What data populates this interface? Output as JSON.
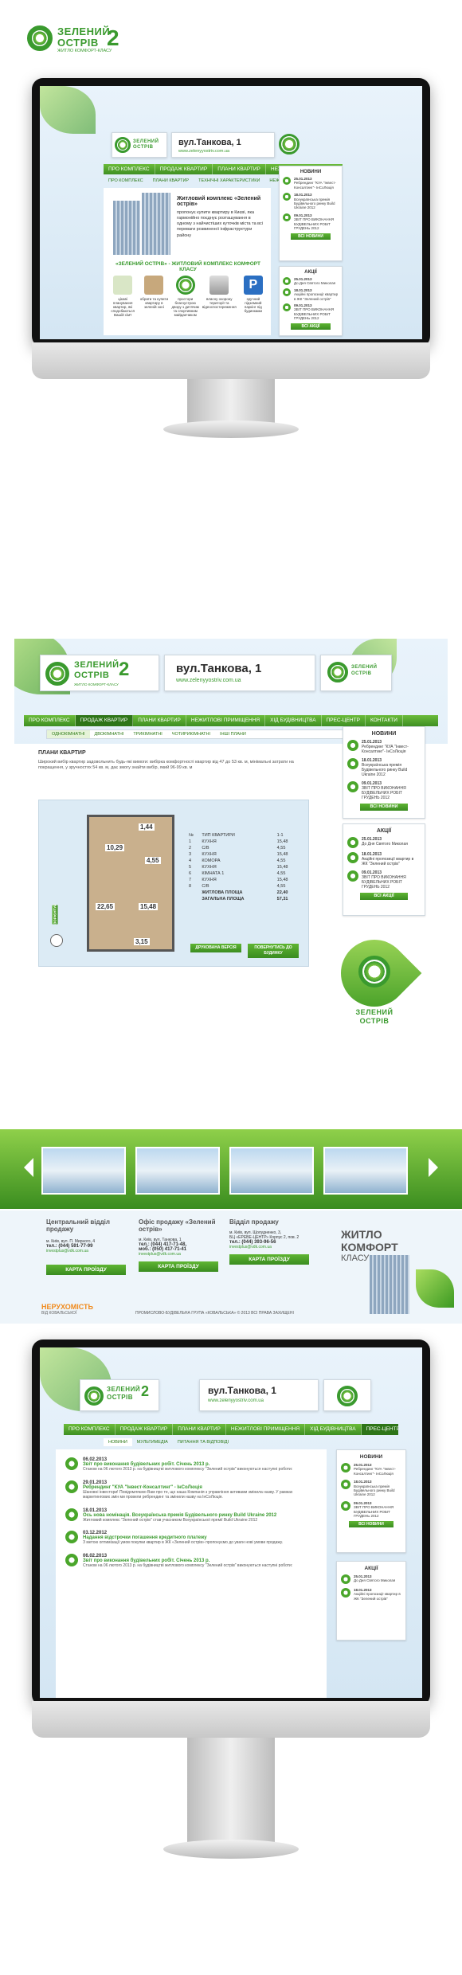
{
  "brand": {
    "name_line1": "ЗЕЛЕНИЙ",
    "name_line2": "ОСТРІВ",
    "numeral": "2",
    "tagline": "ЖИТЛО КОМФОРТ-КЛАСУ"
  },
  "header": {
    "address": "вул.Танкова, 1",
    "url": "www.zelenyyostriv.com.ua"
  },
  "nav": {
    "items": [
      "ПРО КОМПЛЕКС",
      "ПРОДАЖ КВАРТИР",
      "ПЛАНИ КВАРТИР",
      "НЕЖИТЛОВІ ПРИМІЩЕННЯ",
      "ХІД БУДІВНИЦТВА",
      "ПРЕС-ЦЕНТР",
      "КОНТАКТИ"
    ]
  },
  "screen1": {
    "subnav": [
      "ПРО КОМПЛЕКС",
      "ПЛАНИ КВАРТИР",
      "ТЕХНІЧНІ ХАРАКТЕРИСТИКИ",
      "НЕЖИТЛОВІ ПРИМІЩЕННЯ"
    ],
    "promo_title": "Житловий комплекс «Зелений острів»",
    "promo_text": "пропонує купити квартиру в Києві, яка гармонійно поєднує розташування в одному з найчистіших куточків міста та всі переваги розвиненої інфраструктури району",
    "section_title": "«ЗЕЛЕНИЙ ОСТРІВ» - ЖИТЛОВИЙ КОМПЛЕКС КОМФОРТ КЛАСУ",
    "features": [
      "цікаві планування квартир, які сподобаються Вашій сім'ї",
      "обрати та купити квартиру в зеленій зоні",
      "простори благоустрою двору з дитячим та спортивним майданчиком",
      "власну охорону території та відеоспостереження",
      "зручний підземний паркінг під будинками"
    ],
    "news_title": "НОВИНИ",
    "news": [
      {
        "date": "25.01.2013",
        "text": "Ребрендинг \"КУА \"Інвест-Консалтинг\"- ІнСоЛюція"
      },
      {
        "date": "18.01.2013",
        "text": "Всеукраїнська премія Будівельного ринку Build Ukraine 2012"
      },
      {
        "date": "09.01.2013",
        "text": "ЗВІТ ПРО ВИКОНАННЯ БУДІВЕЛЬНИХ РОБІТ ГРУДЕНЬ 2012"
      }
    ],
    "all_news": "ВСІ НОВИНИ",
    "promo_box_title": "АКЦІЇ",
    "promos": [
      {
        "date": "25.01.2013",
        "text": "До Дня Святого Миколая"
      },
      {
        "date": "18.01.2013",
        "text": "Акційні пропозиції квартир в ЖК \"Зелений острів\""
      },
      {
        "date": "09.01.2013",
        "text": "ЗВІТ ПРО ВИКОНАННЯ БУДІВЕЛЬНИХ РОБІТ ГРУДЕНЬ 2012"
      }
    ],
    "all_promos": "ВСІ АКЦІЇ"
  },
  "screen2": {
    "subnav": [
      "ОДНОКІМНАТНІ",
      "ДВОКІМНАТНІ",
      "ТРИКІМНАТНІ",
      "ЧОТИРИКІМНАТНІ",
      "ІНШІ ПЛАНИ"
    ],
    "page_title": "ПЛАНИ КВАРТИР",
    "intro": "Широкий вибір квартир задовольнить будь-які вимоги: вибірка комфортності квартир від 47 до 53 кв. м, мінімальні затрати на покращення, у зручностях 54 кв. м, дає змогу знайти вибір, який 96-99 кв. м",
    "room_labels": [
      "1,44",
      "10,29",
      "4,55",
      "22,65",
      "15,48",
      "3,15"
    ],
    "table_header": [
      "№",
      "ТИП КВАРТИРИ",
      "1-1"
    ],
    "rows": [
      [
        "1",
        "КУХНЯ",
        "15,48"
      ],
      [
        "2",
        "С/В",
        "4,55"
      ],
      [
        "3",
        "КУХНЯ",
        "15,48"
      ],
      [
        "4",
        "КОМОРА",
        "4,55"
      ],
      [
        "5",
        "КУХНЯ",
        "15,48"
      ],
      [
        "6",
        "КІМНАТА 1",
        "4,55"
      ],
      [
        "7",
        "КУХНЯ",
        "15,48"
      ],
      [
        "8",
        "С/В",
        "4,55"
      ]
    ],
    "living_area_label": "ЖИТЛОВА ПЛОЩА",
    "living_area": "22,40",
    "total_area_label": "ЗАГАЛЬНА ПЛОЩА",
    "total_area": "57,31",
    "print_button": "ДРУКОВАНА ВЕРСІЯ",
    "back_button": "ПОВЕРНУТИСЬ ДО БУДИНКУ",
    "compass_label": "ЗОРІЄНТУЙ",
    "news_title": "НОВИНИ",
    "news": [
      {
        "date": "25.01.2013",
        "text": "Ребрендинг \"КУА \"Інвест-Консалтинг\"- ІнСоЛюція"
      },
      {
        "date": "18.01.2013",
        "text": "Всеукраїнська премія Будівельного ринку Build Ukraine 2012"
      },
      {
        "date": "09.01.2013",
        "text": "ЗВІТ ПРО ВИКОНАННЯ БУДІВЕЛЬНИХ РОБІТ ГРУДЕНЬ 2012"
      }
    ],
    "all_news": "ВСІ НОВИНИ",
    "promo_box_title": "АКЦІЇ",
    "promos": [
      {
        "date": "25.01.2013",
        "text": "До Дня Святого Миколая"
      },
      {
        "date": "18.01.2013",
        "text": "Акційні пропозиції квартир в ЖК \"Зелений острів\""
      },
      {
        "date": "09.01.2013",
        "text": "ЗВІТ ПРО ВИКОНАННЯ БУДІВЕЛЬНИХ РОБІТ ГРУДЕНЬ 2012"
      }
    ],
    "all_promos": "ВСІ АКЦІЇ",
    "seal_line1": "ЗЕЛЕНИЙ",
    "seal_line2": "ОСТРІВ"
  },
  "footer": {
    "offices": [
      {
        "title": "Центральний відділ продажу",
        "lines": [
          "м. Київ, вул. П. Мирного, 4",
          "тел.: (044) 591-77-99",
          "investplus@vdk.com.ua"
        ],
        "map_button": "КАРТА ПРОЇЗДУ"
      },
      {
        "title": "Офіс продажу «Зелений острів»",
        "lines": [
          "м. Київ, вул. Танкова, 1",
          "тел.: (044) 417-71-48,",
          "моб.: (050) 417-71-41",
          "investplus@vdk.com.ua"
        ],
        "map_button": "КАРТА ПРОЇЗДУ"
      },
      {
        "title": "Відділ продажу",
        "lines": [
          "м. Київ, вул. Щолудненко, 3,",
          "БЦ «ЕРЕВЕ-ЦЕНТР» Корпус 2, пов. 2",
          "тел.: (044) 393-96-56",
          "investplus@vdk.com.ua"
        ],
        "map_button": "КАРТА ПРОЇЗДУ"
      }
    ],
    "slogan": [
      "ЖИТЛО",
      "КОМФОРТ",
      "КЛАСУ"
    ],
    "partner_line1": "НЕРУХОМІСТЬ",
    "partner_line2": "ВІД КОВАЛЬСЬКОЇ",
    "copyright": "ПРОМИСЛОВО-БУДІВЕЛЬНА ГРУПА «КОВАЛЬСЬКА» © 2013   ВСІ ПРАВА ЗАХИЩЕНІ"
  },
  "screen3": {
    "subnav": [
      "НОВИНИ",
      "МУЛЬТИМЕДІА",
      "ПИТАННЯ ТА ВІДПОВІДІ"
    ],
    "articles": [
      {
        "date": "06.02.2013",
        "title": "Звіт про виконання будівельних робіт. Січень 2013 р.",
        "text": "Станом на 06 лютого 2013 р. на будівництві житлового комплексу \"Зелений острів\" виконуються наступні роботи:"
      },
      {
        "date": "29.01.2013",
        "title": "Ребрендинг \"КУА \"Інвест-Консалтинг\" - ІнСоЛюція",
        "text": "Шановні інвестори! Повідомляємо Вам про те, що наша Компанія з управління активами змінила назву. У рамках маркетингових змін ми провели ребрендинг та змінили назву на ІнСоЛюція."
      },
      {
        "date": "18.01.2013",
        "title": "Ось нова номінація. Всеукраїнська премія Будівельного ринку Build Ukraine 2012",
        "text": "Житловий комплекс \"Зелений острів\" став учасником Всеукраїнської премії Build Ukraine 2012"
      },
      {
        "date": "03.12.2012",
        "title": "Надання відстрочки погашення кредитного платежу",
        "text": "З метою оптимізації умов покупки квартир в ЖК «Зелений острів» пропонуємо до уваги нові умови продажу."
      },
      {
        "date": "06.02.2013",
        "title": "Звіт про виконання будівельних робіт. Січень 2013 р.",
        "text": "Станом на 06 лютого 2013 р. на будівництві житлового комплексу \"Зелений острів\" виконуються наступні роботи:"
      }
    ],
    "news_title": "НОВИНИ",
    "news": [
      {
        "date": "25.01.2013",
        "text": "Ребрендинг \"КУА \"Інвест-Консалтинг\"- ІнСоЛюція"
      },
      {
        "date": "18.01.2013",
        "text": "Всеукраїнська премія Будівельного ринку Build Ukraine 2012"
      },
      {
        "date": "09.01.2013",
        "text": "ЗВІТ ПРО ВИКОНАННЯ БУДІВЕЛЬНИХ РОБІТ ГРУДЕНЬ 2012"
      }
    ],
    "all_news": "ВСІ НОВИНИ",
    "promo_box_title": "АКЦІЇ",
    "promos": [
      {
        "date": "25.01.2013",
        "text": "До Дня Святого Миколая"
      },
      {
        "date": "18.01.2013",
        "text": "Акційні пропозиції квартир в ЖК \"Зелений острів\""
      }
    ]
  },
  "colors": {
    "brand_green": "#3a9a2e",
    "light_green": "#7cc242",
    "sky_blue": "#d4e6f3"
  }
}
